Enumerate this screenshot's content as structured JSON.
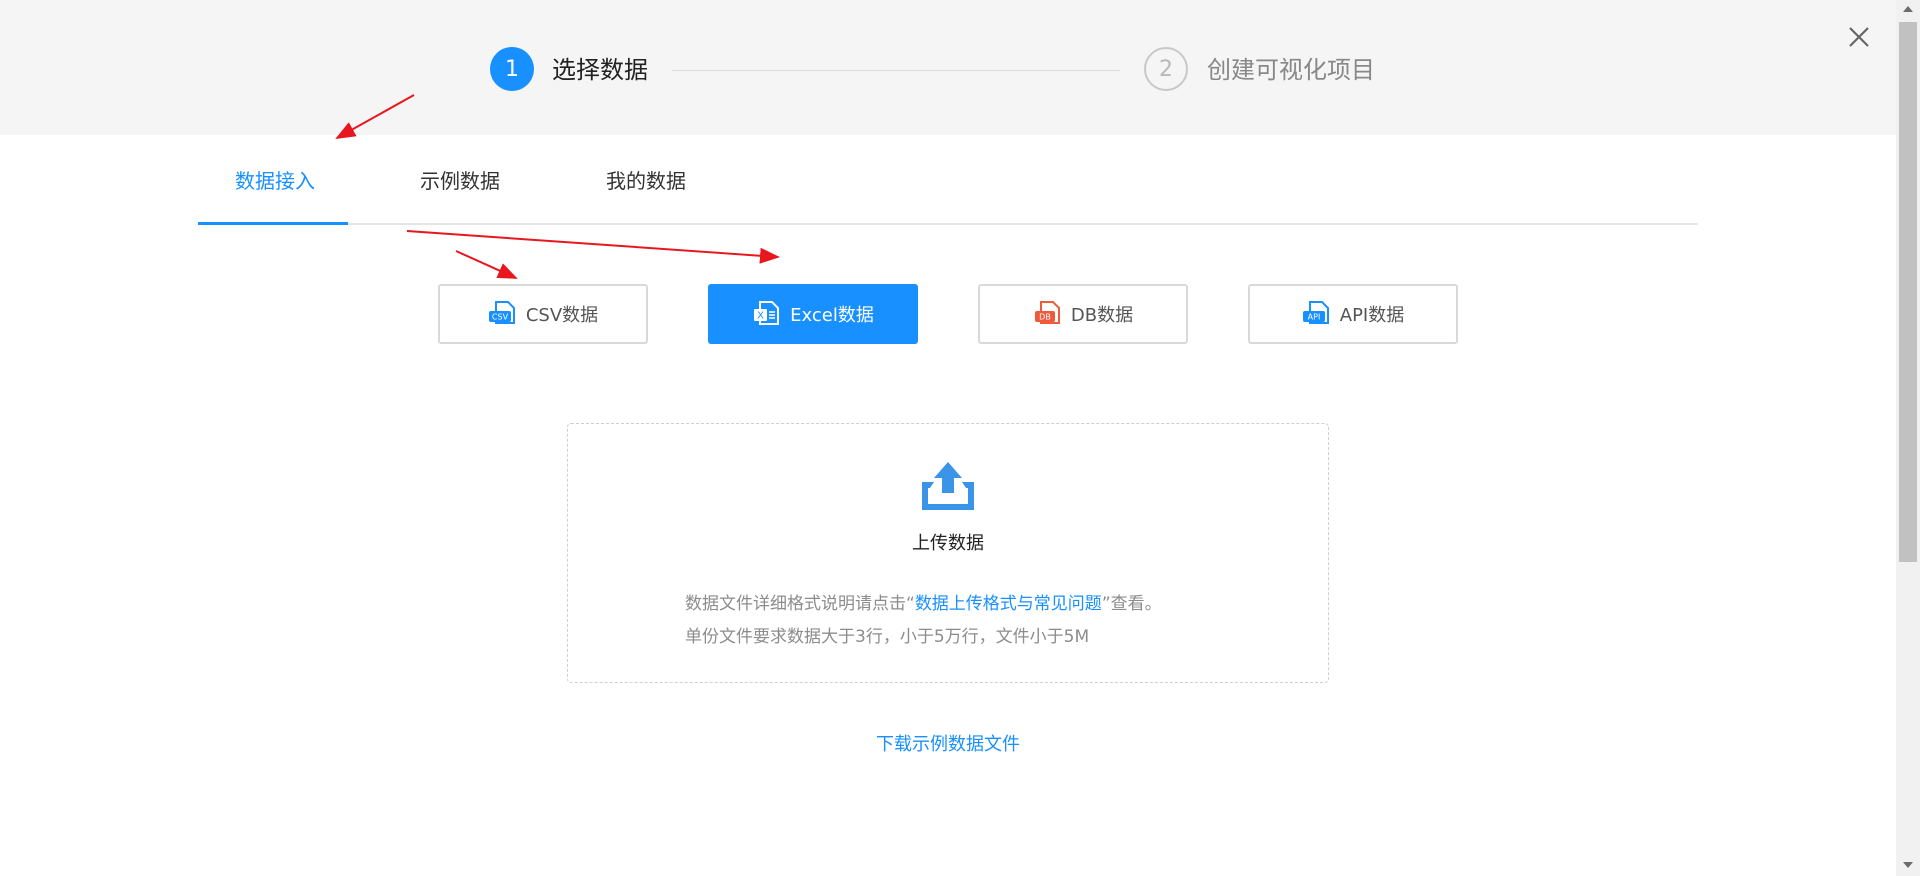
{
  "stepper": {
    "steps": [
      {
        "number": "1",
        "label": "选择数据",
        "state": "active"
      },
      {
        "number": "2",
        "label": "创建可视化项目",
        "state": "pending"
      }
    ]
  },
  "tabs": [
    {
      "label": "数据接入",
      "active": true
    },
    {
      "label": "示例数据",
      "active": false
    },
    {
      "label": "我的数据",
      "active": false
    }
  ],
  "sources": [
    {
      "label": "CSV数据",
      "icon": "csv-file-icon",
      "icon_text": "CSV",
      "active": false
    },
    {
      "label": "Excel数据",
      "icon": "excel-file-icon",
      "icon_text": "X",
      "active": true
    },
    {
      "label": "DB数据",
      "icon": "db-file-icon",
      "icon_text": "DB",
      "active": false
    },
    {
      "label": "API数据",
      "icon": "api-file-icon",
      "icon_text": "API",
      "active": false
    }
  ],
  "upload": {
    "title": "上传数据",
    "desc_prefix": "数据文件详细格式说明请点击“",
    "desc_link": "数据上传格式与常见问题",
    "desc_suffix": "”查看。",
    "requirements": "单份文件要求数据大于3行，小于5万行，文件小于5M"
  },
  "download_link": "下载示例数据文件",
  "colors": {
    "accent": "#1890ff",
    "db_icon": "#f05a3c",
    "annotation_arrow": "#e8161d"
  }
}
